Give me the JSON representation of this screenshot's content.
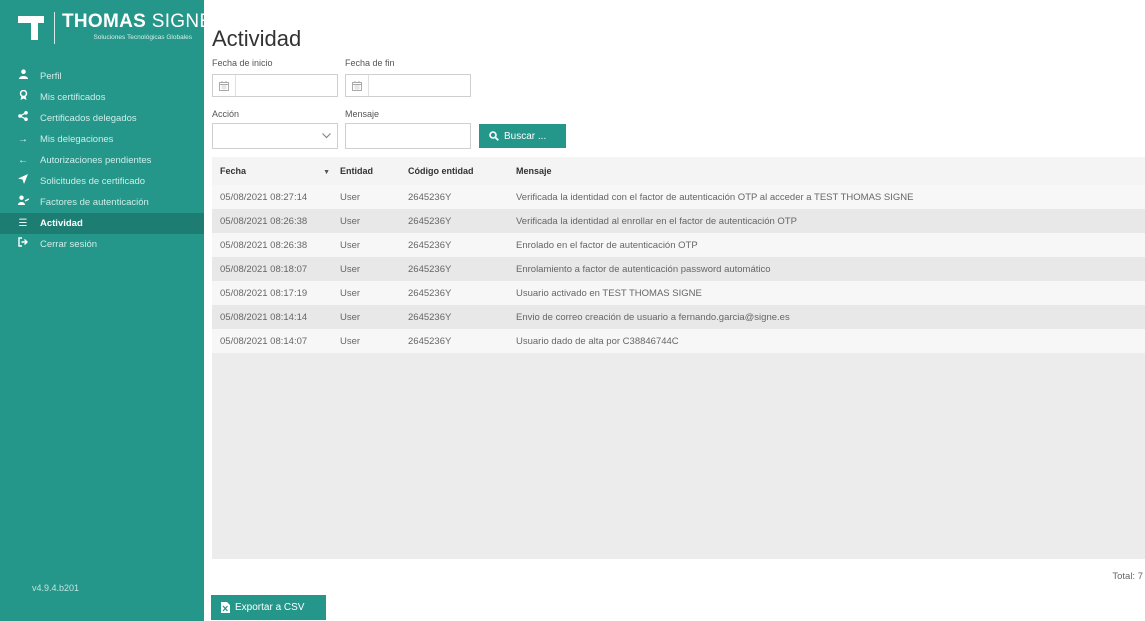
{
  "brand": {
    "name_bold": "THOMAS",
    "name_light": "SIGNE",
    "tagline": "Soluciones Tecnológicas Globales"
  },
  "sidebar": {
    "items": [
      {
        "label": "Perfil",
        "icon": "user-icon"
      },
      {
        "label": "Mis certificados",
        "icon": "certificate-icon"
      },
      {
        "label": "Certificados delegados",
        "icon": "share-icon"
      },
      {
        "label": "Mis delegaciones",
        "icon": "arrow-right-icon"
      },
      {
        "label": "Autorizaciones pendientes",
        "icon": "arrow-left-icon"
      },
      {
        "label": "Solicitudes de certificado",
        "icon": "send-icon"
      },
      {
        "label": "Factores de autenticación",
        "icon": "user-key-icon"
      },
      {
        "label": "Actividad",
        "icon": "list-icon",
        "active": true
      },
      {
        "label": "Cerrar sesión",
        "icon": "sign-out-icon"
      }
    ],
    "version": "v4.9.4.b201"
  },
  "page": {
    "title": "Actividad"
  },
  "filters": {
    "fecha_inicio_label": "Fecha de inicio",
    "fecha_fin_label": "Fecha de fin",
    "accion_label": "Acción",
    "mensaje_label": "Mensaje",
    "fecha_inicio_value": "",
    "fecha_fin_value": "",
    "accion_value": "",
    "mensaje_value": "",
    "search_button": "Buscar ..."
  },
  "table": {
    "columns": [
      "Fecha",
      "Entidad",
      "Código entidad",
      "Mensaje"
    ],
    "rows": [
      [
        "05/08/2021 08:27:14",
        "User",
        "2645236Y",
        "Verificada la identidad con el factor de autenticación OTP al acceder a TEST THOMAS SIGNE"
      ],
      [
        "05/08/2021 08:26:38",
        "User",
        "2645236Y",
        "Verificada la identidad al enrollar en el factor de autenticación OTP"
      ],
      [
        "05/08/2021 08:26:38",
        "User",
        "2645236Y",
        "Enrolado en el factor de autenticación OTP"
      ],
      [
        "05/08/2021 08:18:07",
        "User",
        "2645236Y",
        "Enrolamiento a factor de autenticación password automático"
      ],
      [
        "05/08/2021 08:17:19",
        "User",
        "2645236Y",
        "Usuario activado en TEST THOMAS SIGNE"
      ],
      [
        "05/08/2021 08:14:14",
        "User",
        "2645236Y",
        "Envio de correo creación de usuario a fernando.garcia@signe.es"
      ],
      [
        "05/08/2021 08:14:07",
        "User",
        "2645236Y",
        "Usuario dado de alta por C38846744C"
      ]
    ],
    "total": "Total: 7"
  },
  "export_button": "Exportar a CSV",
  "colors": {
    "brand": "#24968a",
    "active_nav": "#1d7d73"
  }
}
